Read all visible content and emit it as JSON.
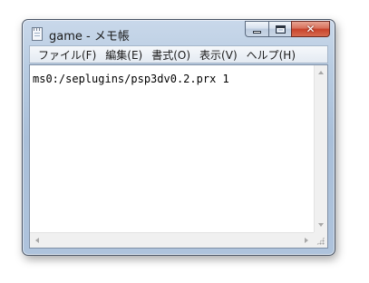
{
  "window": {
    "title": "game - メモ帳"
  },
  "menubar": {
    "items": [
      "ファイル(F)",
      "編集(E)",
      "書式(O)",
      "表示(V)",
      "ヘルプ(H)"
    ]
  },
  "editor": {
    "text": "ms0:/seplugins/psp3dv0.2.prx 1"
  },
  "icons": {
    "app": "notepad-icon",
    "minimize": "minimize-icon",
    "maximize": "maximize-icon",
    "close": "close-icon",
    "close_glyph": "✕"
  },
  "colors": {
    "window_frame": "#a9bfd9",
    "close_button": "#c7412a",
    "editor_background": "#ffffff"
  }
}
